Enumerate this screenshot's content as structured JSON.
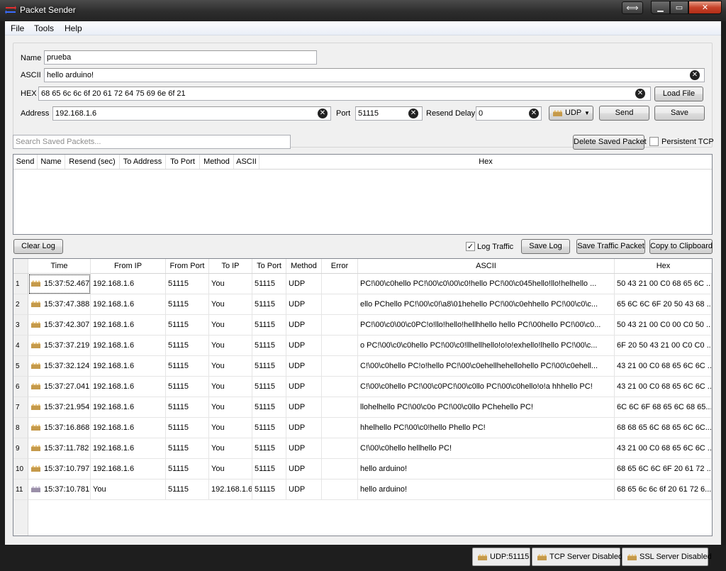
{
  "window": {
    "title": "Packet Sender"
  },
  "menu": [
    "File",
    "Tools",
    "Help"
  ],
  "form": {
    "name_label": "Name",
    "name_value": "prueba",
    "ascii_label": "ASCII",
    "ascii_value": "hello arduino!",
    "hex_label": "HEX",
    "hex_value": "68 65 6c 6c 6f 20 61 72 64 75 69 6e 6f 21",
    "load_file": "Load File",
    "address_label": "Address",
    "address_value": "192.168.1.6",
    "port_label": "Port",
    "port_value": "51115",
    "resend_label": "Resend Delay",
    "resend_value": "0",
    "method_value": "UDP",
    "send": "Send",
    "save": "Save"
  },
  "saved": {
    "search_placeholder": "Search Saved Packets...",
    "delete_button": "Delete Saved Packet",
    "persistent_tcp": "Persistent TCP",
    "columns": [
      "Send",
      "Name",
      "Resend (sec)",
      "To Address",
      "To Port",
      "Method",
      "ASCII",
      "Hex"
    ]
  },
  "traffic": {
    "clear_log": "Clear Log",
    "log_traffic": "Log Traffic",
    "save_log": "Save Log",
    "save_traffic_packet": "Save Traffic Packet",
    "copy_clipboard": "Copy to Clipboard",
    "columns": [
      "Time",
      "From IP",
      "From Port",
      "To IP",
      "To Port",
      "Method",
      "Error",
      "ASCII",
      "Hex"
    ],
    "rows": [
      {
        "n": "1",
        "time": "15:37:52.467",
        "from_ip": "192.168.1.6",
        "from_port": "51115",
        "to_ip": "You",
        "to_port": "51115",
        "method": "UDP",
        "error": "",
        "ascii": "PC!\\00\\c0hello PC!\\00\\c0\\00\\c0!hello PC!\\00\\c045hello!llo!helhello ...",
        "hex": "50 43 21 00 C0 68 65 6C ..."
      },
      {
        "n": "2",
        "time": "15:37:47.388",
        "from_ip": "192.168.1.6",
        "from_port": "51115",
        "to_ip": "You",
        "to_port": "51115",
        "method": "UDP",
        "error": "",
        "ascii": "ello PChello PC!\\00\\c0!\\a8\\01hehello PC!\\00\\c0ehhello PC!\\00\\c0\\c...",
        "hex": "65 6C 6C 6F 20 50 43 68 ..."
      },
      {
        "n": "3",
        "time": "15:37:42.307",
        "from_ip": "192.168.1.6",
        "from_port": "51115",
        "to_ip": "You",
        "to_port": "51115",
        "method": "UDP",
        "error": "",
        "ascii": "PC!\\00\\c0\\00\\c0PC!o!llo!hello!hellhhello hello PC!\\00hello PC!\\00\\c0...",
        "hex": "50 43 21 00 C0 00 C0 50 ..."
      },
      {
        "n": "4",
        "time": "15:37:37.219",
        "from_ip": "192.168.1.6",
        "from_port": "51115",
        "to_ip": "You",
        "to_port": "51115",
        "method": "UDP",
        "error": "",
        "ascii": "o PC!\\00\\c0\\c0hello PC!\\00\\c0!llhellhello!o!o!exhello!lhello PC!\\00\\c...",
        "hex": "6F 20 50 43 21 00 C0 C0 ..."
      },
      {
        "n": "5",
        "time": "15:37:32.124",
        "from_ip": "192.168.1.6",
        "from_port": "51115",
        "to_ip": "You",
        "to_port": "51115",
        "method": "UDP",
        "error": "",
        "ascii": "C!\\00\\c0hello PC!o!hello PC!\\00\\c0ehellhehellohello PC!\\00\\c0ehell...",
        "hex": "43 21 00 C0 68 65 6C 6C ..."
      },
      {
        "n": "6",
        "time": "15:37:27.041",
        "from_ip": "192.168.1.6",
        "from_port": "51115",
        "to_ip": "You",
        "to_port": "51115",
        "method": "UDP",
        "error": "",
        "ascii": "C!\\00\\c0hello PC!\\00\\c0PC!\\00\\c0llo PC!\\00\\c0hello!o!a hhhello PC!",
        "hex": "43 21 00 C0 68 65 6C 6C ..."
      },
      {
        "n": "7",
        "time": "15:37:21.954",
        "from_ip": "192.168.1.6",
        "from_port": "51115",
        "to_ip": "You",
        "to_port": "51115",
        "method": "UDP",
        "error": "",
        "ascii": "llohelhello PC!\\00\\c0o PC!\\00\\c0llo PChehello PC!",
        "hex": "6C 6C 6F 68 65 6C 68 65..."
      },
      {
        "n": "8",
        "time": "15:37:16.868",
        "from_ip": "192.168.1.6",
        "from_port": "51115",
        "to_ip": "You",
        "to_port": "51115",
        "method": "UDP",
        "error": "",
        "ascii": "hhelhello PC!\\00\\c0!hello Phello PC!",
        "hex": "68 68 65 6C 68 65 6C 6C..."
      },
      {
        "n": "9",
        "time": "15:37:11.782",
        "from_ip": "192.168.1.6",
        "from_port": "51115",
        "to_ip": "You",
        "to_port": "51115",
        "method": "UDP",
        "error": "",
        "ascii": "C!\\00\\c0hello hellhello PC!",
        "hex": "43 21 00 C0 68 65 6C 6C ..."
      },
      {
        "n": "10",
        "time": "15:37:10.797",
        "from_ip": "192.168.1.6",
        "from_port": "51115",
        "to_ip": "You",
        "to_port": "51115",
        "method": "UDP",
        "error": "",
        "ascii": "hello arduino!",
        "hex": "68 65 6C 6C 6F 20 61 72 ..."
      },
      {
        "n": "11",
        "time": "15:37:10.781",
        "from_ip": "You",
        "from_port": "51115",
        "to_ip": "192.168.1.6",
        "to_port": "51115",
        "method": "UDP",
        "error": "",
        "ascii": "hello arduino!",
        "hex": "68 65 6c 6c 6f 20 61 72 6..."
      }
    ]
  },
  "status": {
    "udp": "UDP:51115",
    "tcp": "TCP Server Disabled",
    "ssl": "SSL Server Disabled"
  },
  "colors": {
    "accent": "#3399ff",
    "window_frame": "#2d2d2d",
    "close": "#c7432a"
  }
}
